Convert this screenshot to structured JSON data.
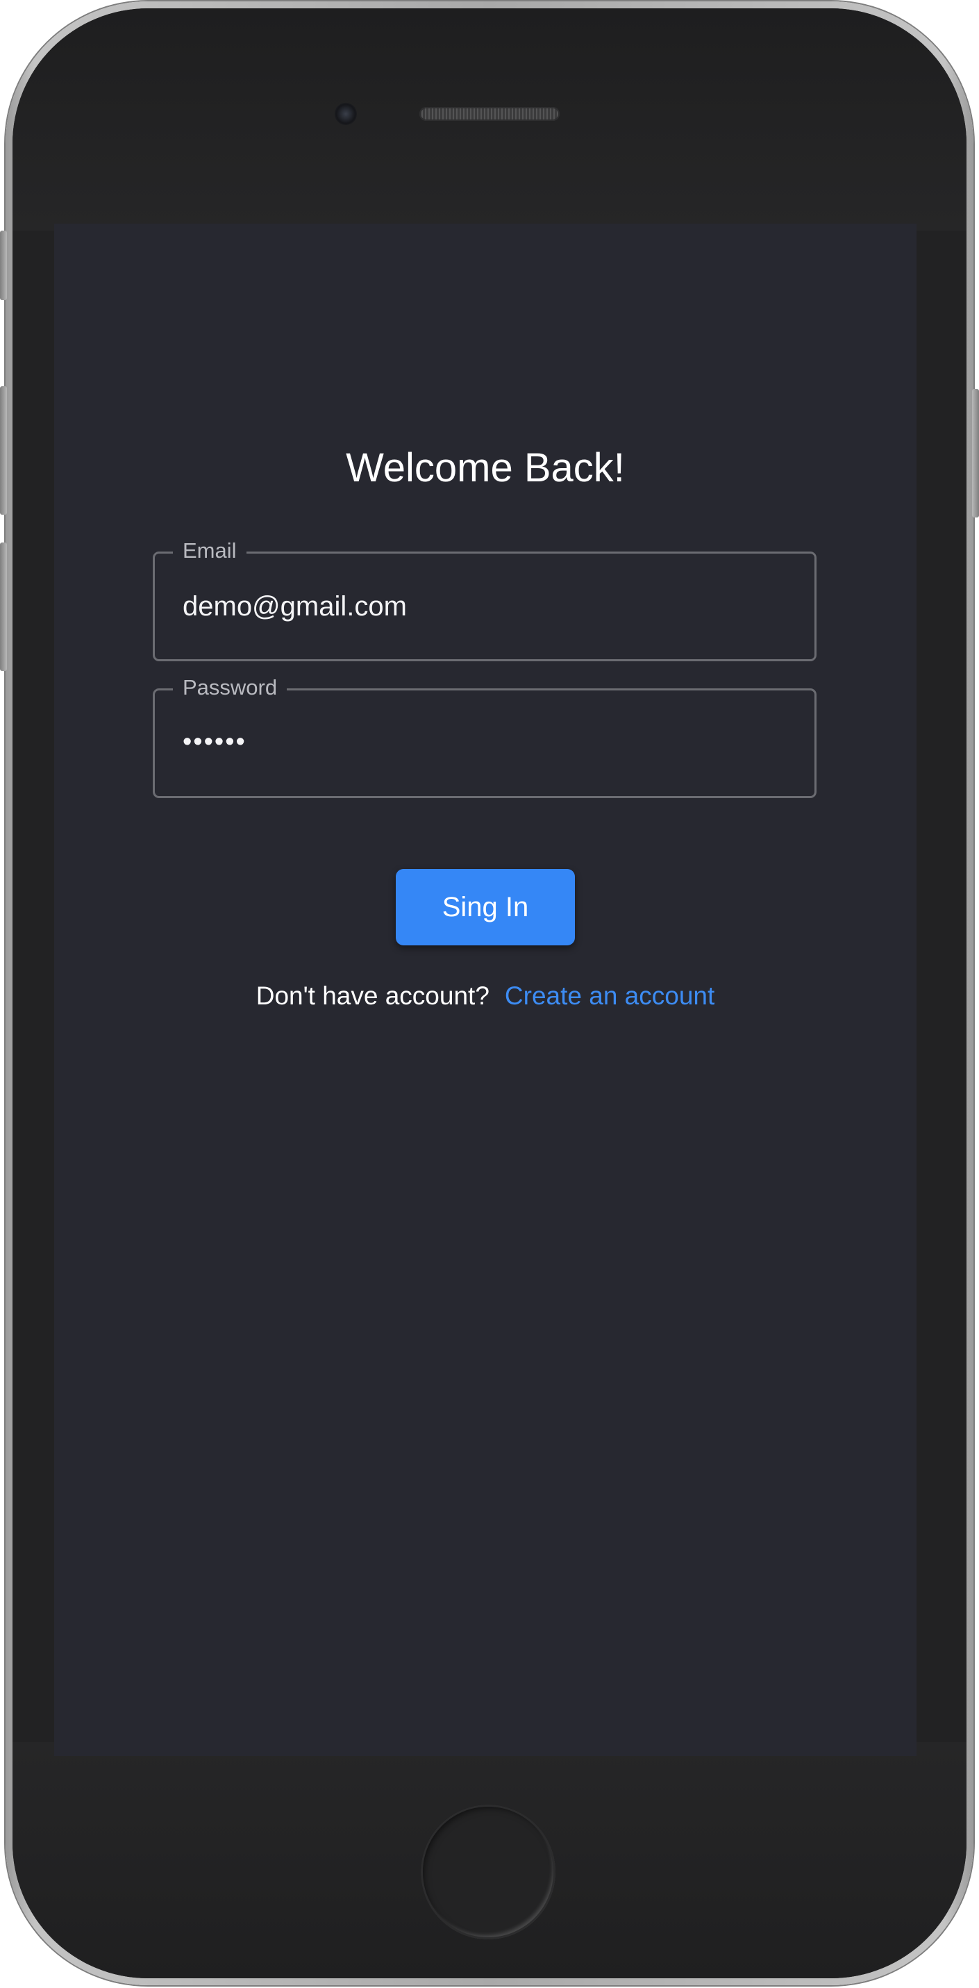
{
  "screen": {
    "title": "Welcome Back!",
    "email": {
      "label": "Email",
      "value": "demo@gmail.com"
    },
    "password": {
      "label": "Password",
      "value": "••••••"
    },
    "signin_label": "Sing In",
    "footer": {
      "prompt": "Don't have account?",
      "link": "Create an account"
    }
  },
  "colors": {
    "screen_background": "#272830",
    "accent": "#3587f6",
    "link": "#3d8cf3",
    "field_border": "#6b6c72"
  },
  "device": {
    "icons": [
      "camera-icon",
      "speaker-icon",
      "home-button-icon"
    ]
  }
}
